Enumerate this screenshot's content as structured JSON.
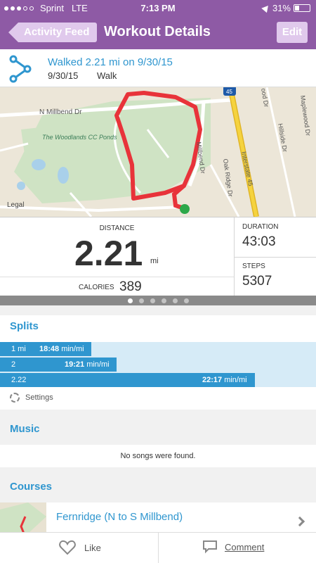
{
  "status_bar": {
    "carrier": "Sprint",
    "network": "LTE",
    "time": "7:13 PM",
    "battery": "31%",
    "battery_level": 0.31,
    "signal_bars": 3
  },
  "nav": {
    "back_label": "Activity Feed",
    "title": "Workout Details",
    "edit_label": "Edit"
  },
  "summary": {
    "title": "Walked 2.21 mi on 9/30/15",
    "date": "9/30/15",
    "type": "Walk",
    "icon": "route-icon"
  },
  "map": {
    "legal": "Legal",
    "labels": [
      "N Millbend Dr",
      "The Woodlands CC Ponds",
      "Millbend Dr",
      "Oak Ridge Dr",
      "Interstate 45",
      "Maplewood Dr",
      "Hillside Dr",
      "ood Dr",
      "45"
    ]
  },
  "stats": {
    "distance_label": "DISTANCE",
    "distance_value": "2.21",
    "distance_unit": "mi",
    "calories_label": "CALORIES",
    "calories_value": "389",
    "duration_label": "DURATION",
    "duration_value": "43:03",
    "steps_label": "STEPS",
    "steps_value": "5307"
  },
  "pager": {
    "pages": 6,
    "active": 1
  },
  "splits": {
    "title": "Splits",
    "rows": [
      {
        "distance": "1 mi",
        "pace": "18:48",
        "unit": "min/mi"
      },
      {
        "distance": "2",
        "pace": "19:21",
        "unit": "min/mi"
      },
      {
        "distance": "2.22",
        "pace": "22:17",
        "unit": "min/mi"
      }
    ],
    "settings_label": "Settings"
  },
  "music": {
    "title": "Music",
    "empty_text": "No songs were found."
  },
  "courses": {
    "title": "Courses",
    "items": [
      {
        "name": "Fernridge (N to S Millbend)"
      }
    ]
  },
  "bottom": {
    "like_label": "Like",
    "comment_label": "Comment"
  },
  "colors": {
    "header": "#8e5aa5",
    "accent": "#2f96cf",
    "route": "#e8333a"
  }
}
